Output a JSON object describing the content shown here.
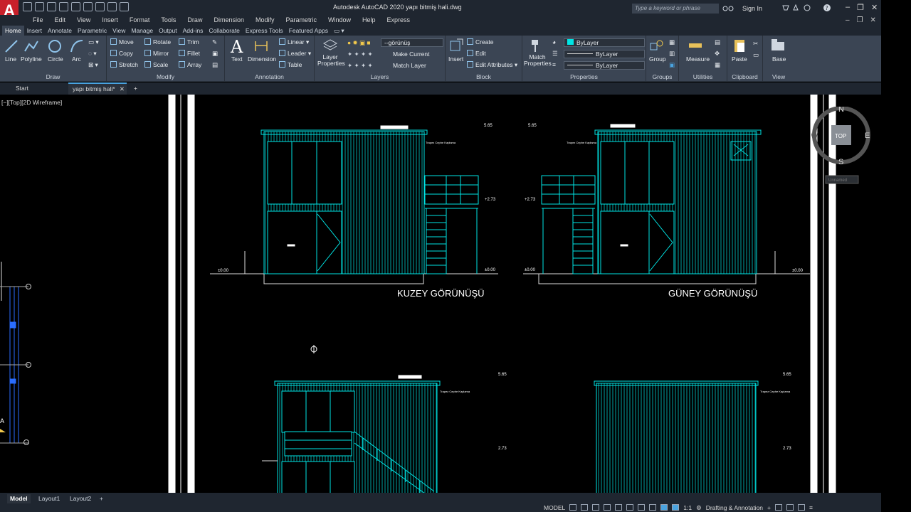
{
  "app": {
    "logo_letter": "A",
    "title": "Autodesk AutoCAD 2020   yapı bitmiş hali.dwg",
    "search_placeholder": "Type a keyword or phrase",
    "sign_in": "Sign In"
  },
  "menu": [
    "File",
    "Edit",
    "View",
    "Insert",
    "Format",
    "Tools",
    "Draw",
    "Dimension",
    "Modify",
    "Parametric",
    "Window",
    "Help",
    "Express"
  ],
  "ribbon_tabs": [
    "Home",
    "Insert",
    "Annotate",
    "Parametric",
    "View",
    "Manage",
    "Output",
    "Add-ins",
    "Collaborate",
    "Express Tools",
    "Featured Apps"
  ],
  "ribbon": {
    "draw": {
      "title": "Draw",
      "line": "Line",
      "polyline": "Polyline",
      "circle": "Circle",
      "arc": "Arc"
    },
    "modify": {
      "title": "Modify",
      "move": "Move",
      "rotate": "Rotate",
      "trim": "Trim",
      "copy": "Copy",
      "mirror": "Mirror",
      "fillet": "Fillet",
      "stretch": "Stretch",
      "scale": "Scale",
      "array": "Array"
    },
    "annotation": {
      "title": "Annotation",
      "text": "Text",
      "dimension": "Dimension",
      "linear": "Linear",
      "leader": "Leader",
      "table": "Table"
    },
    "layers": {
      "title": "Layers",
      "layer_properties": "Layer Properties",
      "current_layer": "--görünüş",
      "make_current": "Make Current",
      "match_layer": "Match Layer"
    },
    "block": {
      "title": "Block",
      "insert": "Insert",
      "create": "Create",
      "edit": "Edit",
      "edit_attributes": "Edit Attributes"
    },
    "properties": {
      "title": "Properties",
      "match_properties": "Match Properties",
      "color": "ByLayer",
      "linetype": "ByLayer",
      "lineweight": "ByLayer"
    },
    "groups": {
      "title": "Groups",
      "group": "Group"
    },
    "utilities": {
      "title": "Utilities",
      "measure": "Measure"
    },
    "clipboard": {
      "title": "Clipboard",
      "paste": "Paste"
    },
    "view": {
      "title": "View",
      "base": "Base"
    }
  },
  "file_tabs": {
    "start": "Start",
    "current": "yapı bitmiş hali*"
  },
  "viewport_label": "[−][Top][2D Wireframe]",
  "drawing": {
    "north_view": "KUZEY GÖRÜNÜŞÜ",
    "south_view": "GÜNEY GÖRÜNÜŞÜ",
    "elevations": {
      "top": "5.65",
      "mid": "+2.73",
      "base": "±0.00",
      "low_mid": "2.73"
    },
    "note": "Trapez Cephe Kaplama"
  },
  "viewcube": {
    "n": "N",
    "s": "S",
    "e": "E",
    "w": "W",
    "face": "TOP",
    "ucs": "Unnamed"
  },
  "layout_tabs": [
    "Model",
    "Layout1",
    "Layout2"
  ],
  "status": {
    "model": "MODEL",
    "scale": "1:1",
    "workspace": "Drafting & Annotation"
  },
  "colors": {
    "accent": "#4aa3df",
    "drawing_line": "#00e5e5",
    "ribbon_bg": "#3b4554",
    "titlebar_bg": "#1f2630"
  }
}
